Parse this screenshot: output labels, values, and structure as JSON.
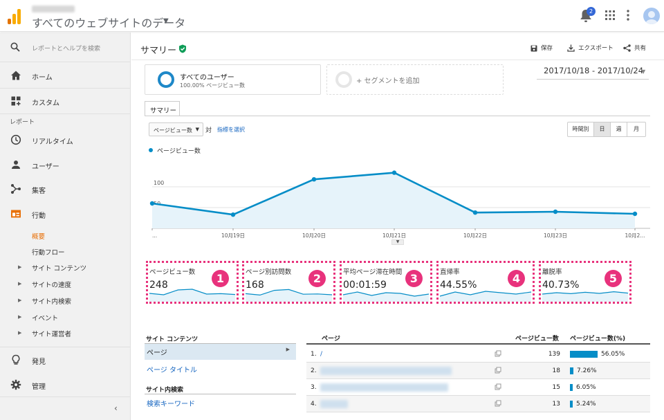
{
  "header": {
    "view_title": "すべてのウェブサイトのデータ",
    "notification_count": "2"
  },
  "sidebar": {
    "search_placeholder": "レポートとヘルプを検索",
    "home": "ホーム",
    "custom": "カスタム",
    "reports_section": "レポート",
    "realtime": "リアルタイム",
    "audience": "ユーザー",
    "acquisition": "集客",
    "behavior": "行動",
    "behavior_sub": [
      "概要",
      "行動フロー",
      "サイト コンテンツ",
      "サイトの速度",
      "サイト内検索",
      "イベント",
      "サイト運営者"
    ],
    "discover": "発見",
    "admin": "管理"
  },
  "page": {
    "title": "サマリー",
    "save": "保存",
    "export": "エクスポート",
    "share": "共有",
    "segment_name": "すべてのユーザー",
    "segment_sub": "100.00% ページビュー数",
    "add_segment": "+ セグメントを追加",
    "date_range": "2017/10/18 - 2017/10/24",
    "tab": "サマリー",
    "metric_select": "ページビュー数",
    "vs": "対",
    "pick_metric": "指標を選択",
    "granularity": [
      "時間別",
      "日",
      "週",
      "月"
    ],
    "granularity_selected": "日"
  },
  "chart_data": {
    "type": "area",
    "series": [
      {
        "name": "ページビュー数",
        "values": [
          60,
          33,
          118,
          134,
          38,
          40,
          35
        ]
      }
    ],
    "x_tick_labels": [
      "...",
      "10月19日",
      "10月20日",
      "10月21日",
      "10月22日",
      "10月23日",
      "10月2..."
    ],
    "y_tick_labels": [
      "100",
      "50"
    ],
    "ylim": [
      0,
      175
    ],
    "legend_position": "top-left",
    "color": "#058dc7"
  },
  "scorecards": [
    {
      "title": "ページビュー数",
      "value": "248",
      "badge": "1",
      "spark": [
        50,
        40,
        75,
        80,
        45,
        48,
        42
      ]
    },
    {
      "title": "ページ別訪問数",
      "value": "168",
      "badge": "2",
      "spark": [
        48,
        38,
        72,
        78,
        44,
        46,
        40
      ]
    },
    {
      "title": "平均ページ滞在時間",
      "value": "00:01:59",
      "badge": "3",
      "spark": [
        40,
        60,
        35,
        55,
        50,
        30,
        45
      ]
    },
    {
      "title": "直帰率",
      "value": "44.55%",
      "badge": "4",
      "spark": [
        30,
        60,
        40,
        65,
        55,
        45,
        60
      ]
    },
    {
      "title": "離脱率",
      "value": "40.73%",
      "badge": "5",
      "spark": [
        45,
        55,
        48,
        58,
        50,
        62,
        52
      ]
    }
  ],
  "left_table": {
    "site_content_header": "サイト コンテンツ",
    "items": [
      "ページ",
      "ページ タイトル"
    ],
    "site_search_header": "サイト内検索",
    "search_items": [
      "検索キーワード"
    ]
  },
  "right_table": {
    "col_page": "ページ",
    "col_pageviews": "ページビュー数",
    "col_pageviews_pct": "ページビュー数(%)",
    "rows": [
      {
        "no": "1.",
        "page": "/",
        "pv": "139",
        "pct": "56.05%",
        "frac": 0.5605
      },
      {
        "no": "2.",
        "page": "",
        "pv": "18",
        "pct": "7.26%",
        "frac": 0.0726
      },
      {
        "no": "3.",
        "page": "",
        "pv": "15",
        "pct": "6.05%",
        "frac": 0.0605
      },
      {
        "no": "4.",
        "page": "",
        "pv": "13",
        "pct": "5.24%",
        "frac": 0.0524
      }
    ]
  }
}
